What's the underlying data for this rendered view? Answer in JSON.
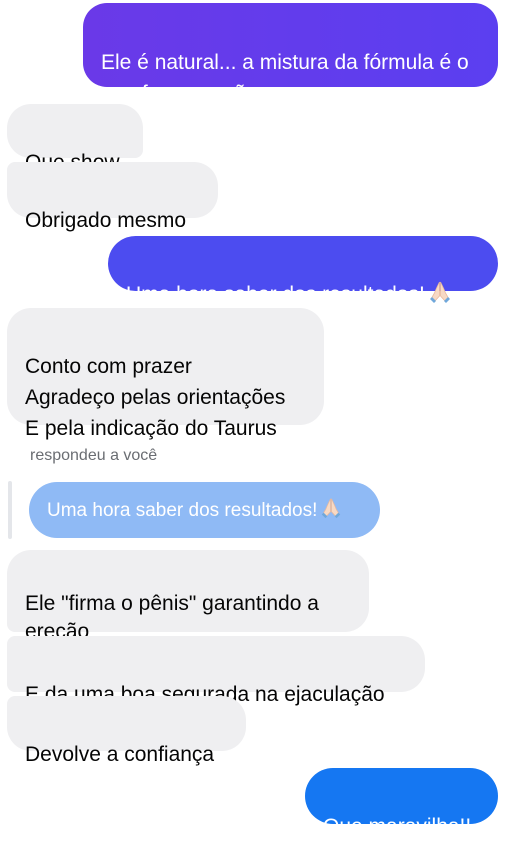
{
  "messages": {
    "m1": "Ele é natural... a mistura da fórmula é o que faz a reação",
    "m2": "Que show",
    "m3": "Obrigado mesmo",
    "m4": "Uma hora saber dos resultados!",
    "m5": "Conto com prazer\nAgradeço pelas orientações\nE pela indicação do Taurus",
    "reply_label": "respondeu a você",
    "quoted": "Uma hora saber dos resultados!",
    "m6": "Ele \"firma o pênis\" garantindo a ereção",
    "m7": "E da uma boa segurada na ejaculação",
    "m8": "Devolve a confiança",
    "m9": "Que maravilha!!"
  },
  "icons": {
    "prayer": "folded-hands-emoji"
  },
  "colors": {
    "outgoing_purple": "#5b3ff0",
    "outgoing_indigo": "#4c4cf0",
    "outgoing_blue": "#1577f2",
    "quoted_blue": "#8fbaf5",
    "incoming_gray": "#efeff1",
    "incoming_text": "#050505"
  }
}
